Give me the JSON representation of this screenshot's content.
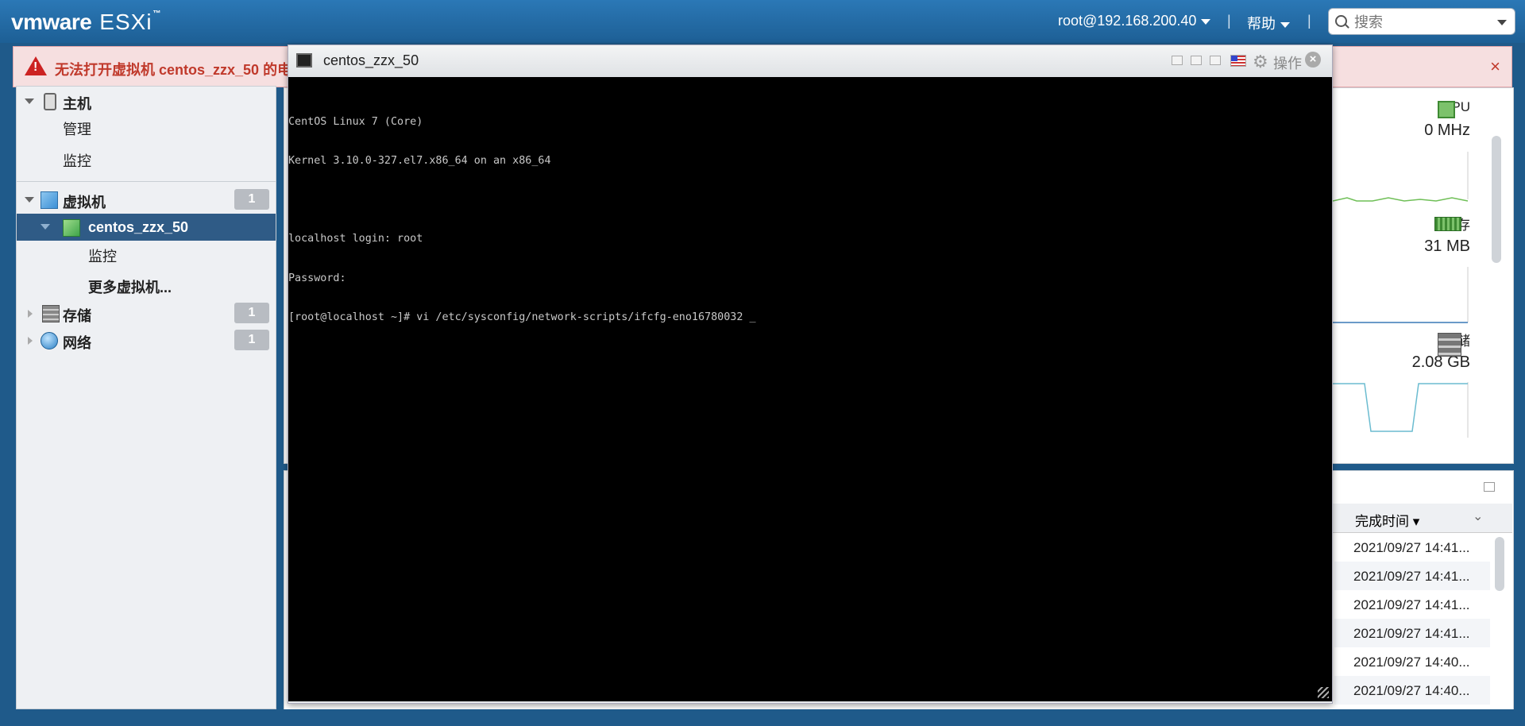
{
  "header": {
    "brand_vm": "vmware",
    "brand_esxi": "ESXi",
    "brand_tm": "™",
    "user": "root@192.168.200.40",
    "help": "帮助",
    "sep": "|",
    "search_placeholder": "搜索"
  },
  "alert": {
    "message": "无法打开虚拟机 centos_zzx_50 的电",
    "close": "×"
  },
  "nav": {
    "host": "主机",
    "host_manage": "管理",
    "host_monitor": "监控",
    "vms": "虚拟机",
    "vms_count": "1",
    "vm_selected": "centos_zzx_50",
    "vm_monitor": "监控",
    "more_vms": "更多虚拟机...",
    "storage": "存储",
    "storage_count": "1",
    "network": "网络",
    "network_count": "1"
  },
  "stats": {
    "cpu_label": "CPU",
    "cpu_value": "0 MHz",
    "mem_label": "内存",
    "mem_value": "31 MB",
    "store_label": "存储",
    "store_value": "2.08 GB"
  },
  "tasks": {
    "col_completed": "完成时间 ▾",
    "rows": [
      "2021/09/27 14:41...",
      "2021/09/27 14:41...",
      "2021/09/27 14:41...",
      "2021/09/27 14:41...",
      "2021/09/27 14:40...",
      "2021/09/27 14:40..."
    ]
  },
  "console": {
    "title": "centos_zzx_50",
    "actions": "操作",
    "lines": [
      "CentOS Linux 7 (Core)",
      "Kernel 3.10.0-327.el7.x86_64 on an x86_64",
      "",
      "localhost login: root",
      "Password:",
      "[root@localhost ~]# vi /etc/sysconfig/network-scripts/ifcfg-eno16780032 _"
    ]
  },
  "colors": {
    "header_bg": "#2b78b6",
    "alert_bg": "#f6dfe0",
    "alert_text": "#c0392b",
    "nav_selected": "#2f5b86",
    "console_bg": "#000000"
  }
}
